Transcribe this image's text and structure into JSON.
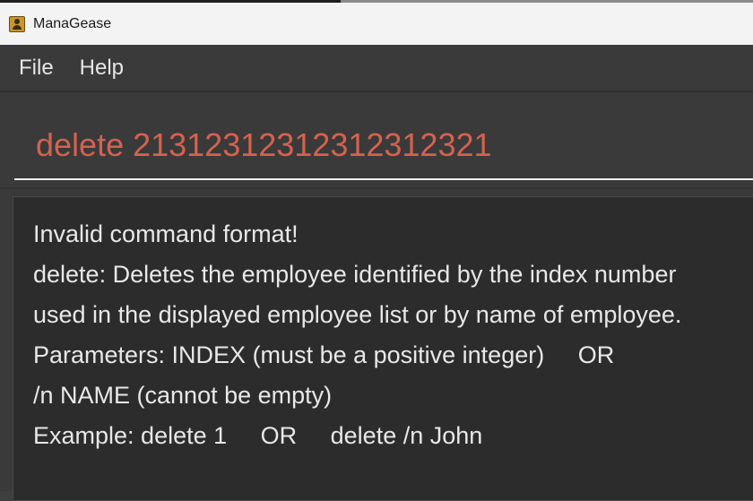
{
  "window": {
    "title": "ManaGease",
    "icon": "address-book-icon"
  },
  "menu": {
    "items": [
      {
        "label": "File"
      },
      {
        "label": "Help"
      }
    ]
  },
  "command": {
    "text": "delete 21312312312312312321",
    "color": "#d4624f"
  },
  "result": {
    "lines": [
      "Invalid command format!",
      "delete: Deletes the employee identified by the index number",
      "used in the displayed employee list or by name of employee.",
      "Parameters: INDEX (must be a positive integer)     OR",
      "/n NAME (cannot be empty)",
      "Example: delete 1     OR     delete /n John"
    ]
  },
  "theme": {
    "background": "#3a3a3a",
    "result_background": "#2c2c2c",
    "text": "#e8e8e8"
  }
}
